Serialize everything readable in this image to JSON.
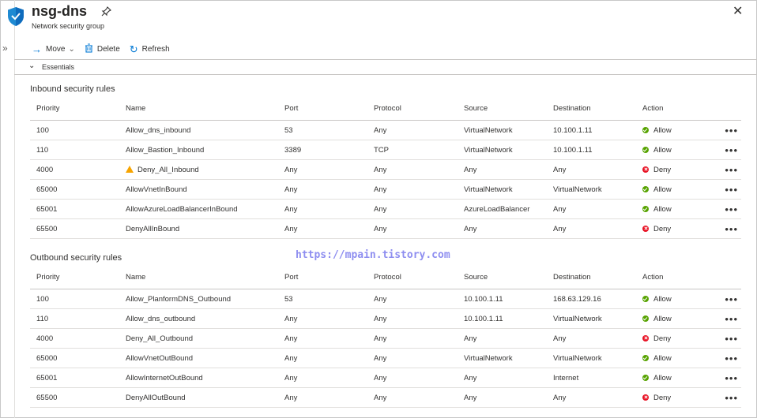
{
  "header": {
    "title": "nsg-dns",
    "subtitle": "Network security group"
  },
  "toolbar": {
    "move_label": "Move",
    "delete_label": "Delete",
    "refresh_label": "Refresh"
  },
  "essentials_label": "Essentials",
  "columns": [
    "Priority",
    "Name",
    "Port",
    "Protocol",
    "Source",
    "Destination",
    "Action"
  ],
  "inbound": {
    "title": "Inbound security rules",
    "rules": [
      {
        "priority": "100",
        "name": "Allow_dns_inbound",
        "port": "53",
        "protocol": "Any",
        "source": "VirtualNetwork",
        "destination": "10.100.1.11",
        "action": "Allow",
        "warning": false
      },
      {
        "priority": "110",
        "name": "Allow_Bastion_Inbound",
        "port": "3389",
        "protocol": "TCP",
        "source": "VirtualNetwork",
        "destination": "10.100.1.11",
        "action": "Allow",
        "warning": false
      },
      {
        "priority": "4000",
        "name": "Deny_All_Inbound",
        "port": "Any",
        "protocol": "Any",
        "source": "Any",
        "destination": "Any",
        "action": "Deny",
        "warning": true
      },
      {
        "priority": "65000",
        "name": "AllowVnetInBound",
        "port": "Any",
        "protocol": "Any",
        "source": "VirtualNetwork",
        "destination": "VirtualNetwork",
        "action": "Allow",
        "warning": false
      },
      {
        "priority": "65001",
        "name": "AllowAzureLoadBalancerInBound",
        "port": "Any",
        "protocol": "Any",
        "source": "AzureLoadBalancer",
        "destination": "Any",
        "action": "Allow",
        "warning": false
      },
      {
        "priority": "65500",
        "name": "DenyAllInBound",
        "port": "Any",
        "protocol": "Any",
        "source": "Any",
        "destination": "Any",
        "action": "Deny",
        "warning": false
      }
    ]
  },
  "outbound": {
    "title": "Outbound security rules",
    "rules": [
      {
        "priority": "100",
        "name": "Allow_PlanformDNS_Outbound",
        "port": "53",
        "protocol": "Any",
        "source": "10.100.1.11",
        "destination": "168.63.129.16",
        "action": "Allow",
        "warning": false
      },
      {
        "priority": "110",
        "name": "Allow_dns_outbound",
        "port": "Any",
        "protocol": "Any",
        "source": "10.100.1.11",
        "destination": "VirtualNetwork",
        "action": "Allow",
        "warning": false
      },
      {
        "priority": "4000",
        "name": "Deny_All_Outbound",
        "port": "Any",
        "protocol": "Any",
        "source": "Any",
        "destination": "Any",
        "action": "Deny",
        "warning": false
      },
      {
        "priority": "65000",
        "name": "AllowVnetOutBound",
        "port": "Any",
        "protocol": "Any",
        "source": "VirtualNetwork",
        "destination": "VirtualNetwork",
        "action": "Allow",
        "warning": false
      },
      {
        "priority": "65001",
        "name": "AllowInternetOutBound",
        "port": "Any",
        "protocol": "Any",
        "source": "Any",
        "destination": "Internet",
        "action": "Allow",
        "warning": false
      },
      {
        "priority": "65500",
        "name": "DenyAllOutBound",
        "port": "Any",
        "protocol": "Any",
        "source": "Any",
        "destination": "Any",
        "action": "Deny",
        "warning": false
      }
    ]
  },
  "more_glyph": "•••",
  "watermark": "https://mpain.tistory.com",
  "icons": {
    "resource": "shield-icon",
    "pin": "pin-icon",
    "close": "close-icon",
    "move": "arrow-right-icon",
    "delete": "trash-icon",
    "refresh": "refresh-icon",
    "expand": "double-chevron-right-icon",
    "collapse": "chevron-down-icon",
    "allow": "check-circle-icon",
    "deny": "error-circle-icon",
    "warning": "warning-icon"
  },
  "colors": {
    "accent": "#0078d4",
    "allow": "#57a300",
    "deny": "#e81123",
    "warning": "#f7a400"
  }
}
